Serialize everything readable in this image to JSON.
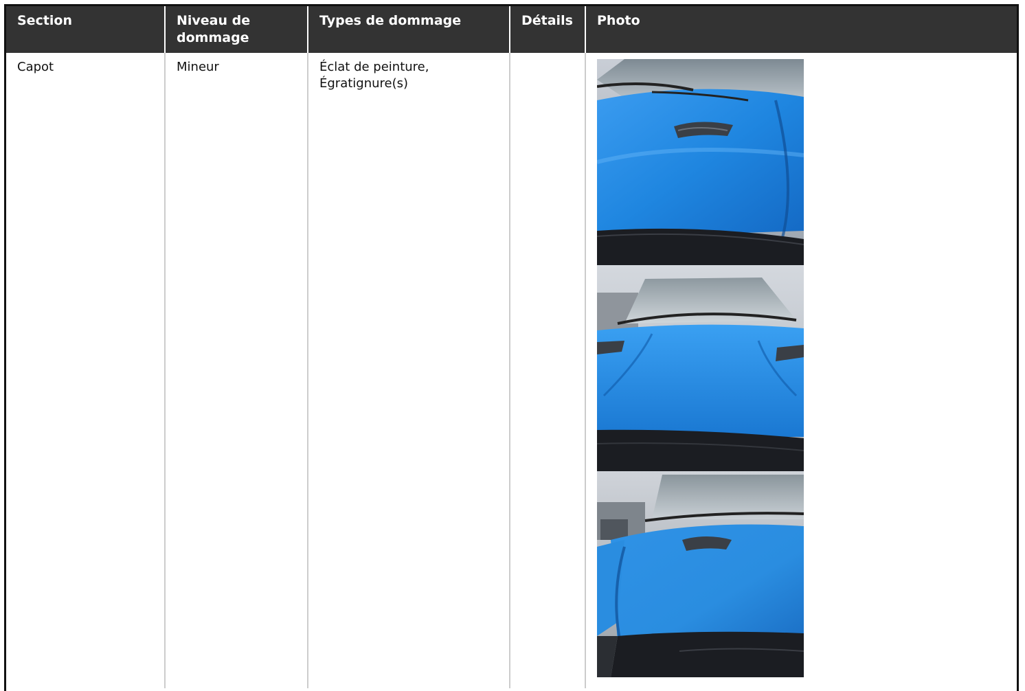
{
  "table": {
    "headers": [
      "Section",
      "Niveau de dommage",
      "Types de dommage",
      "Détails",
      "Photo"
    ],
    "rows": [
      {
        "section": "Capot",
        "level": "Mineur",
        "types": "Éclat de peinture, Égratignure(s)",
        "details": "",
        "photos": [
          {
            "subject": "hood-closeup-left-scoop"
          },
          {
            "subject": "hood-front-two-scoops"
          },
          {
            "subject": "hood-angle-right-scoop"
          }
        ]
      }
    ]
  },
  "colors": {
    "header_bg": "#333333",
    "header_text": "#ffffff",
    "paint_blue": "#2a8de0",
    "grille": "#1b1d22"
  }
}
